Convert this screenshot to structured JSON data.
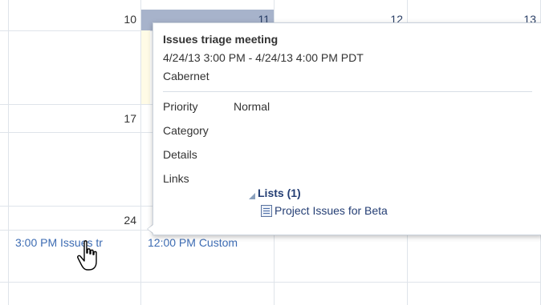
{
  "calendar": {
    "day_numbers": [
      "10",
      "11",
      "12",
      "13",
      "17",
      "24"
    ],
    "events": {
      "ev1": "3:00 PM Issues tr",
      "ev2": "12:00 PM Custom"
    }
  },
  "popup": {
    "title": "Issues triage meeting",
    "time": "4/24/13 3:00 PM - 4/24/13 4:00 PM PDT",
    "location": "Cabernet",
    "fields": {
      "priority_label": "Priority",
      "priority_value": "Normal",
      "category_label": "Category",
      "details_label": "Details",
      "links_label": "Links"
    },
    "lists": {
      "header": "Lists (1)",
      "item": "Project Issues for Beta"
    }
  },
  "icons": {
    "cursor": "hand-pointer-icon",
    "list": "list-document-icon",
    "expand": "expanded-triangle-icon"
  },
  "colors": {
    "selected_header": "#a7b3cb",
    "event_link": "#3d6cb3",
    "list_link": "#243e74"
  }
}
